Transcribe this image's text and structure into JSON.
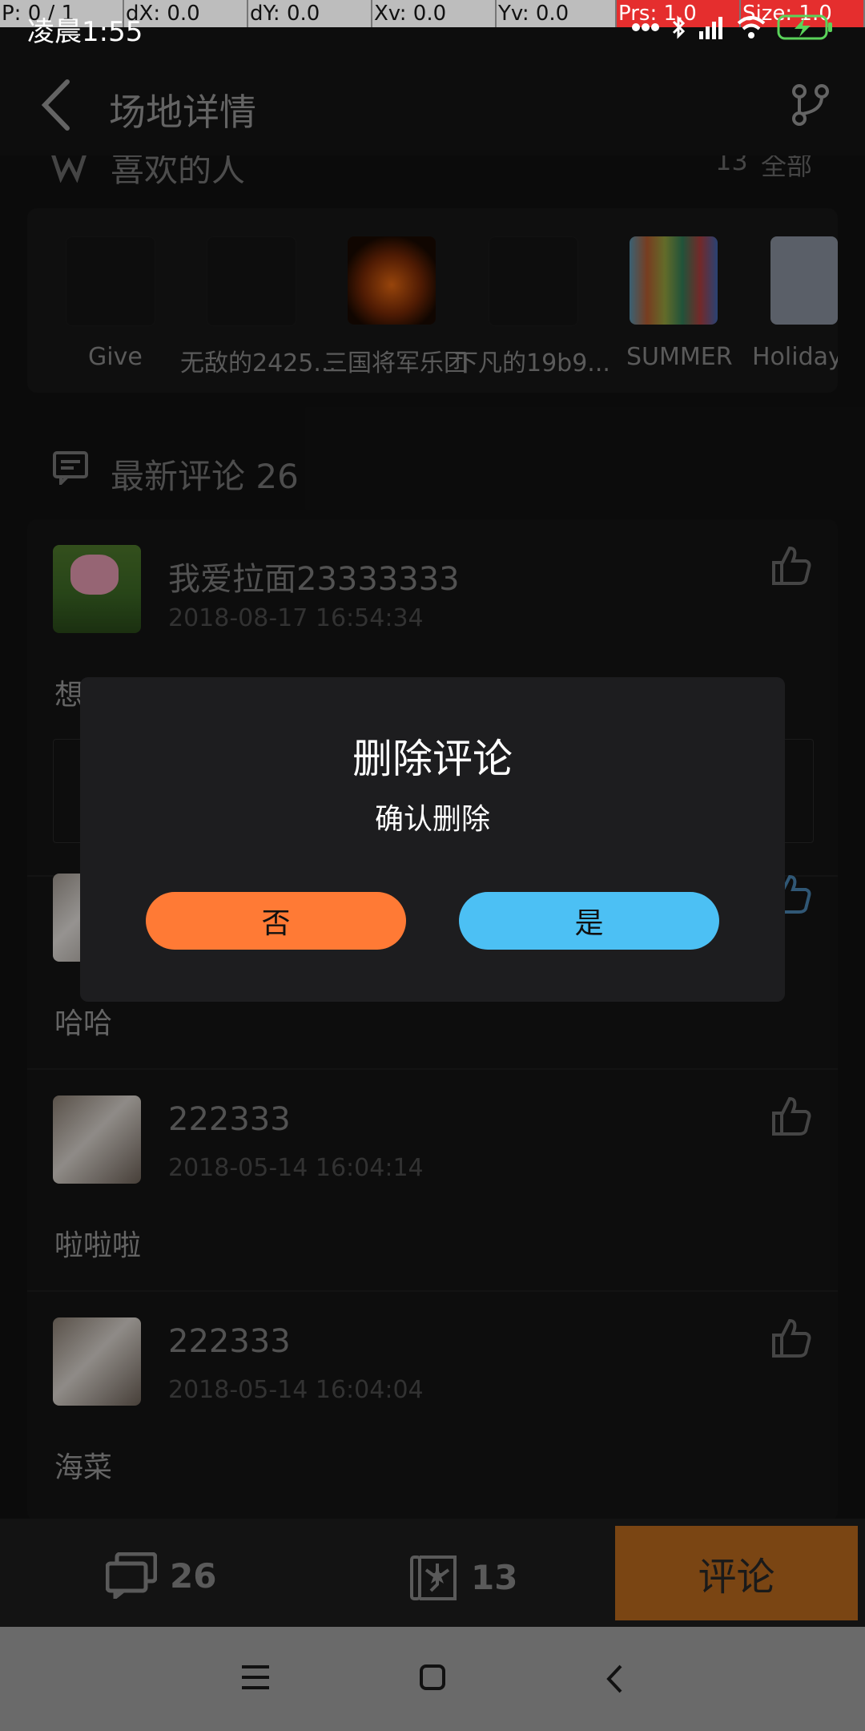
{
  "debug_bar": {
    "p": "P: 0 / 1",
    "dx": "dX: 0.0",
    "dy": "dY: 0.0",
    "xv": "Xv: 0.0",
    "yv": "Yv: 0.0",
    "prs": "Prs: 1.0",
    "size": "Size: 1.0"
  },
  "status_bar": {
    "time": "凌晨1:55"
  },
  "header": {
    "title": "场地详情"
  },
  "likes_section": {
    "title": "喜欢的人",
    "count": "13",
    "all_label": "全部",
    "users": [
      {
        "name": "Give"
      },
      {
        "name": "无敌的2425..."
      },
      {
        "name": "三国将军乐团"
      },
      {
        "name": "下凡的19b9..."
      },
      {
        "name": "SUMMER"
      },
      {
        "name": "Holiday /"
      }
    ]
  },
  "comments_section": {
    "title": "最新评论 26",
    "comments": [
      {
        "name": "我爱拉面23333333",
        "date": "2018-08-17 16:54:34",
        "body": "想"
      },
      {
        "name": "",
        "date": "",
        "body": "哈哈"
      },
      {
        "name": "222333",
        "date": "2018-05-14 16:04:14",
        "body": "啦啦啦"
      },
      {
        "name": "222333",
        "date": "2018-05-14 16:04:04",
        "body": "海菜"
      }
    ]
  },
  "dialog": {
    "title": "删除评论",
    "message": "确认删除",
    "no_label": "否",
    "yes_label": "是"
  },
  "bottom_bar": {
    "comments_count": "26",
    "favorites_count": "13",
    "comment_button": "评论"
  },
  "colors": {
    "no_button": "#ff7a35",
    "yes_button": "#4cc0f4",
    "comment_button": "#7a4513"
  }
}
